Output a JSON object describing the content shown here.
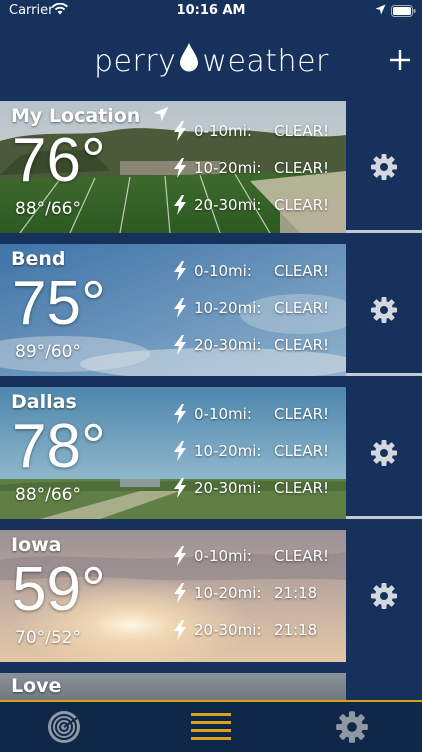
{
  "status_bar": {
    "carrier": "Carrier",
    "time": "10:16 AM"
  },
  "header": {
    "logo_left": "perry",
    "logo_right": "weather"
  },
  "cards": [
    {
      "name": "My Location",
      "temp": "76°",
      "hilo": "88°/66°",
      "rings": [
        {
          "range": "0-10mi:",
          "status": "CLEAR!"
        },
        {
          "range": "10-20mi:",
          "status": "CLEAR!"
        },
        {
          "range": "20-30mi:",
          "status": "CLEAR!"
        }
      ]
    },
    {
      "name": "Bend",
      "temp": "75°",
      "hilo": "89°/60°",
      "rings": [
        {
          "range": "0-10mi:",
          "status": "CLEAR!"
        },
        {
          "range": "10-20mi:",
          "status": "CLEAR!"
        },
        {
          "range": "20-30mi:",
          "status": "CLEAR!"
        }
      ]
    },
    {
      "name": "Dallas",
      "temp": "78°",
      "hilo": "88°/66°",
      "rings": [
        {
          "range": "0-10mi:",
          "status": "CLEAR!"
        },
        {
          "range": "10-20mi:",
          "status": "CLEAR!"
        },
        {
          "range": "20-30mi:",
          "status": "CLEAR!"
        }
      ]
    },
    {
      "name": "Iowa",
      "temp": "59°",
      "hilo": "70°/52°",
      "rings": [
        {
          "range": "0-10mi:",
          "status": "CLEAR!"
        },
        {
          "range": "10-20mi:",
          "status": "21:18"
        },
        {
          "range": "20-30mi:",
          "status": "21:18"
        }
      ]
    },
    {
      "name": "Love"
    }
  ],
  "colors": {
    "navy": "#16325c",
    "tabbar": "#0f2849",
    "accent": "#d9a21b"
  },
  "icons": [
    "wifi-icon",
    "location-arrow-icon",
    "battery-icon",
    "water-drop-icon",
    "plus-icon",
    "lightning-icon",
    "gear-icon",
    "radar-icon",
    "list-icon"
  ]
}
